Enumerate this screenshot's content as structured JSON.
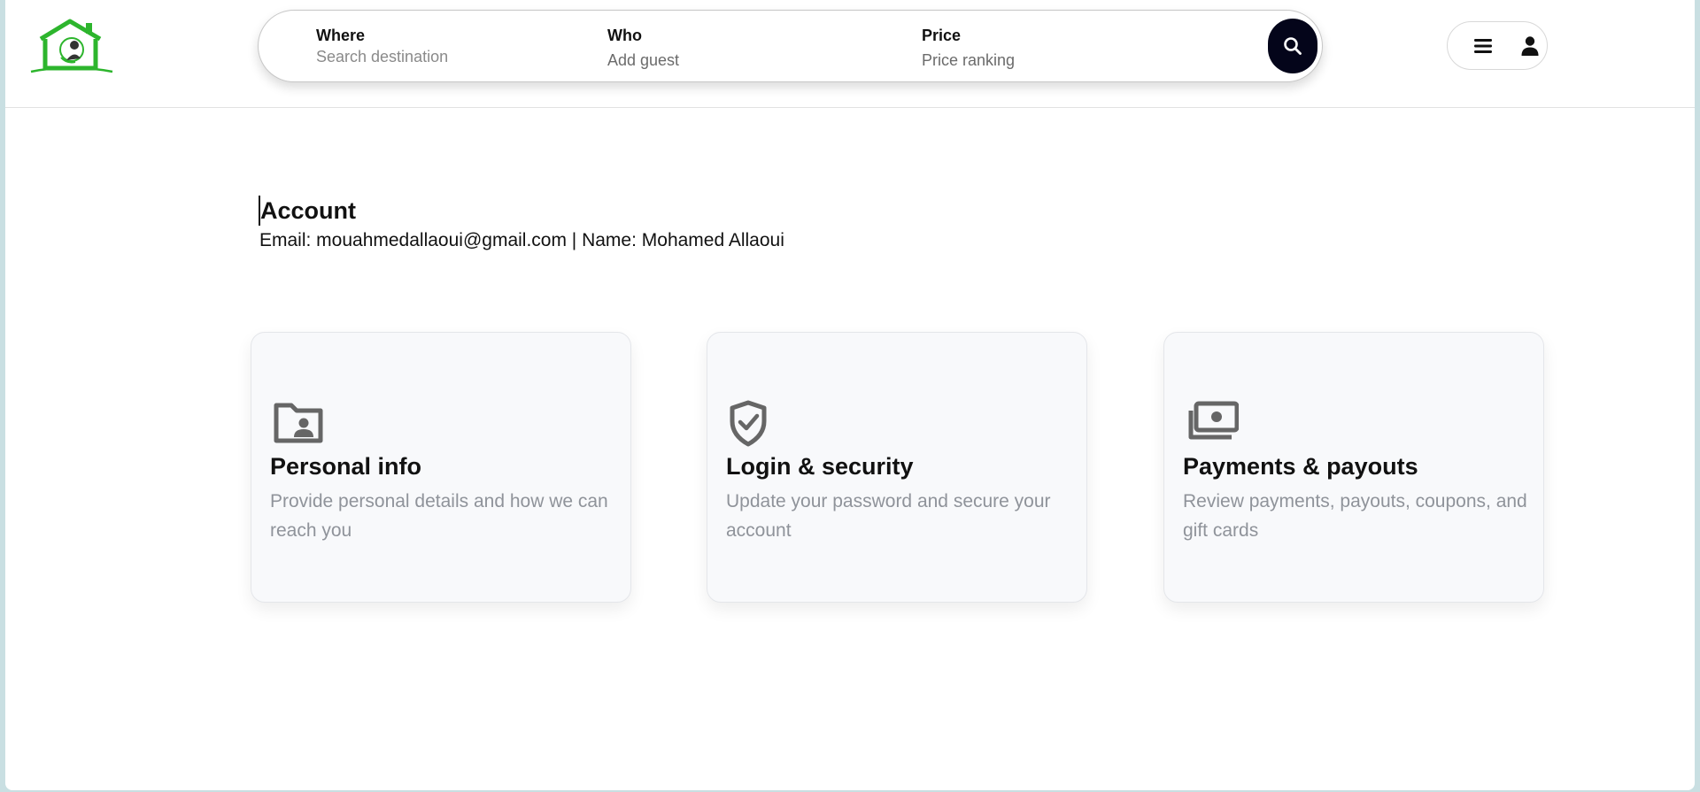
{
  "header": {
    "logo_alt": "home-logo",
    "search": {
      "where": {
        "label": "Where",
        "placeholder": "Search destination"
      },
      "who": {
        "label": "Who",
        "value": "Add guest"
      },
      "price": {
        "label": "Price",
        "value": "Price ranking"
      },
      "button_icon": "search-icon"
    },
    "user_menu": {
      "menu_icon": "hamburger-icon",
      "user_icon": "person-icon"
    }
  },
  "account": {
    "title": "Account",
    "info": "Email: mouahmedallaoui@gmail.com | Name: Mohamed Allaoui"
  },
  "cards": [
    {
      "icon": "folder-user-icon",
      "title": "Personal info",
      "description": "Provide personal details and how we can reach you"
    },
    {
      "icon": "shield-check-icon",
      "title": "Login & security",
      "description": "Update your password and secure your account"
    },
    {
      "icon": "money-icon",
      "title": "Payments & payouts",
      "description": "Review payments, payouts, coupons, and gift cards"
    }
  ],
  "colors": {
    "accent_green": "#2db52d",
    "search_button": "#04051a",
    "muted_text": "#8f939a"
  }
}
